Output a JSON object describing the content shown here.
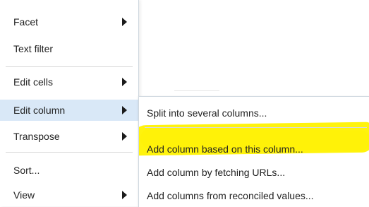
{
  "menu": {
    "items": [
      {
        "label": "Facet",
        "has_submenu": true
      },
      {
        "label": "Text filter",
        "has_submenu": false
      },
      {
        "label": "Edit cells",
        "has_submenu": true
      },
      {
        "label": "Edit column",
        "has_submenu": true,
        "active": true
      },
      {
        "label": "Transpose",
        "has_submenu": true
      },
      {
        "label": "Sort...",
        "has_submenu": false
      },
      {
        "label": "View",
        "has_submenu": true
      }
    ]
  },
  "submenu": {
    "items": [
      {
        "label": "Split into several columns..."
      },
      {
        "label": "Add column based on this column..."
      },
      {
        "label": "Add column by fetching URLs..."
      },
      {
        "label": "Add columns from reconciled values..."
      }
    ]
  },
  "colors": {
    "active_item": "#d9e8f7",
    "highlight": "#fff200",
    "separator": "#d9d9d9"
  }
}
